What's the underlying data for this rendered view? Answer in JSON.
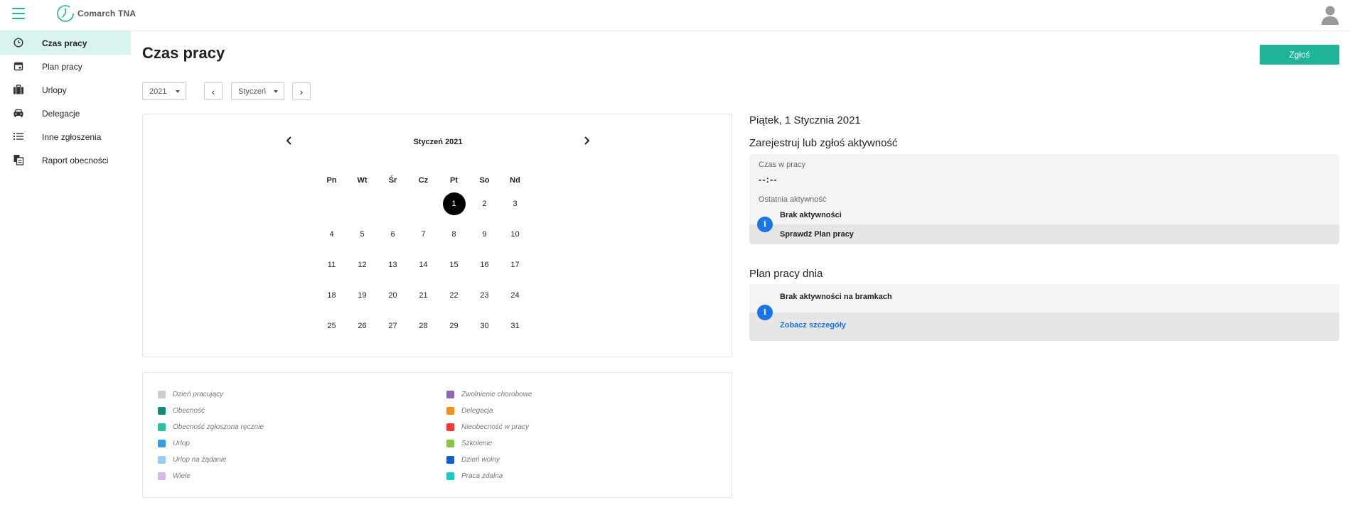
{
  "app": {
    "logo_text": "Comarch TNA"
  },
  "sidebar": {
    "items": [
      {
        "label": "Czas pracy",
        "icon": "clock-icon"
      },
      {
        "label": "Plan pracy",
        "icon": "calendar-icon"
      },
      {
        "label": "Urlopy",
        "icon": "suitcase-icon"
      },
      {
        "label": "Delegacje",
        "icon": "car-icon"
      },
      {
        "label": "Inne zgłoszenia",
        "icon": "list-icon"
      },
      {
        "label": "Raport obecności",
        "icon": "documents-icon"
      }
    ]
  },
  "header": {
    "title": "Czas pracy",
    "report_button": "Zgłoś"
  },
  "controls": {
    "year": "2021",
    "month": "Styczeń"
  },
  "calendar": {
    "title": "Styczeń 2021",
    "weekdays": [
      "Pn",
      "Wt",
      "Śr",
      "Cz",
      "Pt",
      "So",
      "Nd"
    ],
    "weeks": [
      [
        "",
        "",
        "",
        "",
        "1",
        "2",
        "3"
      ],
      [
        "4",
        "5",
        "6",
        "7",
        "8",
        "9",
        "10"
      ],
      [
        "11",
        "12",
        "13",
        "14",
        "15",
        "16",
        "17"
      ],
      [
        "18",
        "19",
        "20",
        "21",
        "22",
        "23",
        "24"
      ],
      [
        "25",
        "26",
        "27",
        "28",
        "29",
        "30",
        "31"
      ]
    ],
    "selected_day": "1"
  },
  "legend": {
    "left": [
      {
        "label": "Dzień pracujący",
        "color": "#cccccc"
      },
      {
        "label": "Obecność",
        "color": "#168a79"
      },
      {
        "label": "Obecność zgłoszona ręcznie",
        "color": "#2bbf9e"
      },
      {
        "label": "Urlop",
        "color": "#3b9be0"
      },
      {
        "label": "Urlop na żądanie",
        "color": "#99cdf5"
      },
      {
        "label": "Wiele",
        "color": "#d3b8e3"
      }
    ],
    "right": [
      {
        "label": "Zwolnienie chorobowe",
        "color": "#9067b7"
      },
      {
        "label": "Delegacja",
        "color": "#f5921e"
      },
      {
        "label": "Nieobecność w pracy",
        "color": "#ec3b37"
      },
      {
        "label": "Szkolenie",
        "color": "#8cc34a"
      },
      {
        "label": "Dzień wolny",
        "color": "#1460c4"
      },
      {
        "label": "Praca zdalna",
        "color": "#1fc9c1"
      }
    ]
  },
  "day_panel": {
    "date_title": "Piątek, 1 Stycznia 2021",
    "register_title": "Zarejestruj lub zgłoś aktywność",
    "time_label": "Czas w pracy",
    "time_value": "--:--",
    "last_activity_label": "Ostatnia aktywność",
    "no_activity": "Brak aktywności",
    "check_plan": "Sprawdź Plan pracy",
    "plan_title": "Plan pracy dnia",
    "no_gate_activity": "Brak aktywności na bramkach",
    "see_details": "Zobacz szczegóły",
    "info_icon_glyph": "i"
  }
}
